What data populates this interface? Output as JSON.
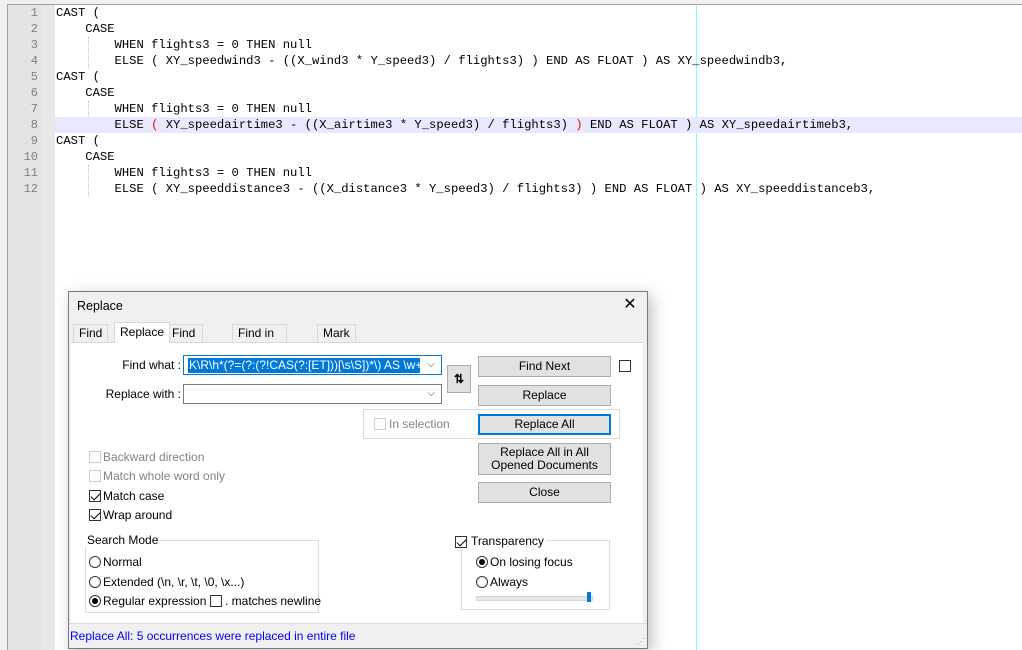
{
  "editor": {
    "lines": [
      {
        "num": "1",
        "text": "CAST ("
      },
      {
        "num": "2",
        "text": "    CASE"
      },
      {
        "num": "3",
        "text": "        WHEN flights3 = 0 THEN null"
      },
      {
        "num": "4",
        "text": "        ELSE ( XY_speedwind3 - ((X_wind3 * Y_speed3) / flights3) ) END AS FLOAT ) AS XY_speedwindb3,"
      },
      {
        "num": "5",
        "text": "CAST ("
      },
      {
        "num": "6",
        "text": "    CASE"
      },
      {
        "num": "7",
        "text": "        WHEN flights3 = 0 THEN null"
      },
      {
        "num": "8",
        "pre": "        ELSE ",
        "brace_open": "(",
        "mid": " XY_speedairtime3 - ((X_airtime3 * Y_speed3) / flights3) ",
        "brace_close": ")",
        "post": " END AS FLOAT ) AS XY_speedairtimeb3,"
      },
      {
        "num": "9",
        "text": "CAST ("
      },
      {
        "num": "10",
        "text": "    CASE"
      },
      {
        "num": "11",
        "text": "        WHEN flights3 = 0 THEN null"
      },
      {
        "num": "12",
        "text": "        ELSE ( XY_speeddistance3 - ((X_distance3 * Y_speed3) / flights3) ) END AS FLOAT ) AS XY_speeddistanceb3,"
      }
    ],
    "current_line": 8,
    "colors": {
      "current_line_bg": "#e8e8ff",
      "brace_highlight": "#ff0000",
      "edge_line": "#80ffff"
    }
  },
  "dialog": {
    "title": "Replace",
    "close_icon": "close-icon",
    "tabs": [
      {
        "label": "Find",
        "active": false
      },
      {
        "label": "Replace",
        "active": true
      },
      {
        "label": "Find in Files",
        "active": false
      },
      {
        "label": "Find in Projects",
        "active": false
      },
      {
        "label": "Mark",
        "active": false
      }
    ],
    "find_what_label": "Find what :",
    "find_what_value": "K\\R\\h*(?=(?:(?!CAS(?:[ET]))[\\s\\S])*\\) AS \\w+,)",
    "replace_with_label": "Replace with :",
    "replace_with_value": "",
    "swap_icon": "swap-arrows-icon",
    "swap_glyph": "⇅",
    "dropdown_glyph": "⌵",
    "in_selection_label": "In selection",
    "buttons": {
      "find_next": "Find Next",
      "replace": "Replace",
      "replace_all": "Replace All",
      "replace_all_opened": "Replace All in All Opened Documents",
      "close": "Close"
    },
    "options": {
      "backward_direction": {
        "label": "Backward direction",
        "checked": false,
        "enabled": false
      },
      "match_whole_word": {
        "label": "Match whole word only",
        "checked": false,
        "enabled": false
      },
      "match_case": {
        "label": "Match case",
        "checked": true,
        "enabled": true
      },
      "wrap_around": {
        "label": "Wrap around",
        "checked": true,
        "enabled": true
      }
    },
    "search_mode": {
      "title": "Search Mode",
      "normal": "Normal",
      "extended": "Extended (\\n, \\r, \\t, \\0, \\x...)",
      "regex": "Regular expression",
      "selected": "regex",
      "matches_newline": ". matches newline",
      "matches_newline_checked": false
    },
    "transparency": {
      "label": "Transparency",
      "checked": true,
      "on_losing_focus": "On losing focus",
      "always": "Always",
      "selected": "on_losing_focus",
      "level_percent": 100
    },
    "status_text": "Replace All: 5 occurrences were replaced in entire file",
    "grip_glyph": "⋰"
  }
}
